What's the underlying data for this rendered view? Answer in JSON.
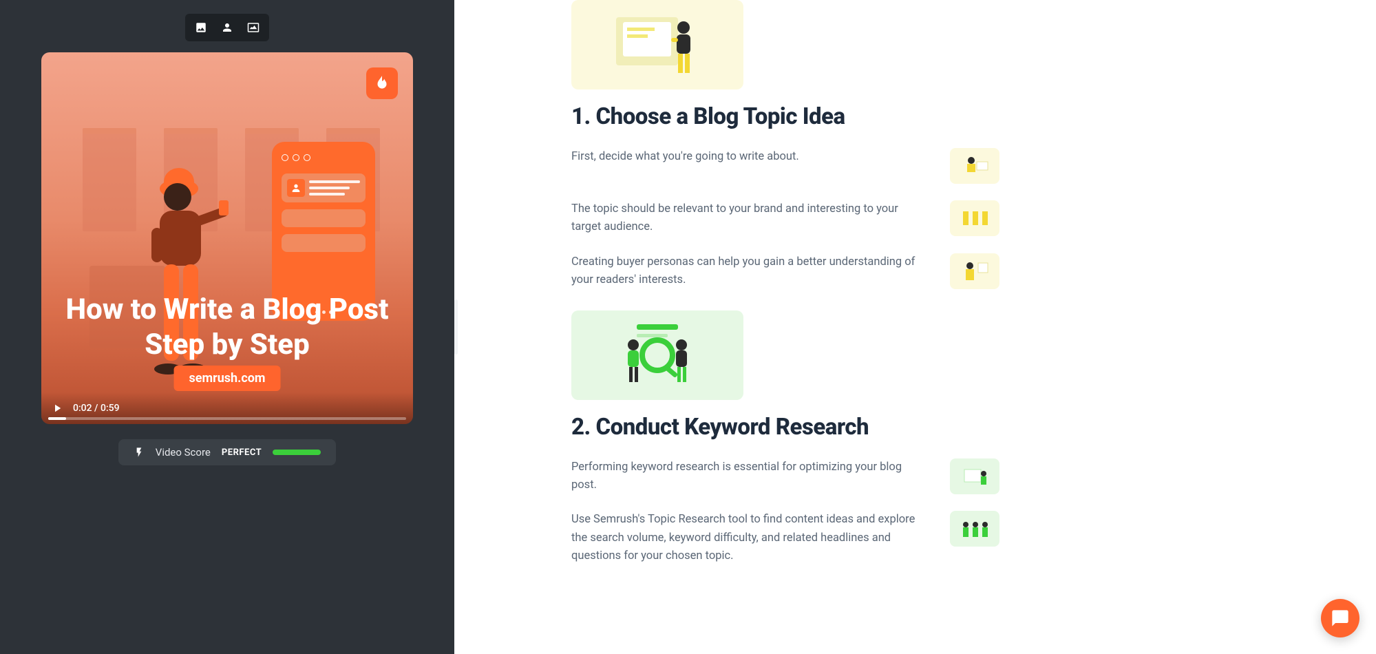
{
  "video": {
    "title": "How to Write a Blog Post Step by Step",
    "brand": "semrush.com",
    "currentTime": "0:02",
    "duration": "0:59",
    "timeDisplay": "0:02 / 0:59"
  },
  "score": {
    "label": "Video Score",
    "value": "PERFECT"
  },
  "sections": [
    {
      "heading": "1. Choose a Blog Topic Idea",
      "theme": "yellow",
      "paragraphs": [
        "First, decide what you're going to write about.",
        "The topic should be relevant to your brand and interesting to your target audience.",
        "Creating buyer personas can help you gain a better understanding of your readers' interests."
      ]
    },
    {
      "heading": "2. Conduct Keyword Research",
      "theme": "green",
      "paragraphs": [
        "Performing keyword research is essential for optimizing your blog post.",
        "Use Semrush's Topic Research tool to find content ideas and explore the search volume, keyword difficulty, and related headlines and questions for your chosen topic."
      ]
    }
  ]
}
